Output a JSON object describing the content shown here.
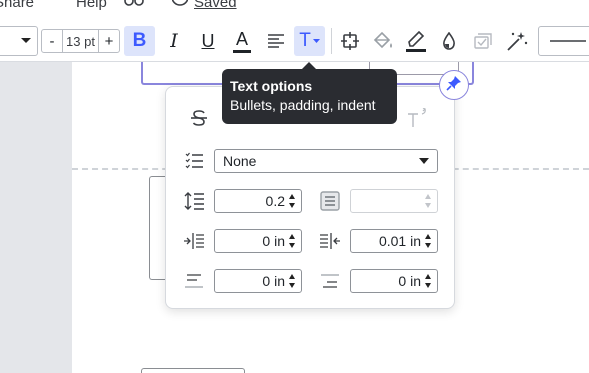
{
  "menubar": {
    "items": [
      {
        "label": "Share"
      },
      {
        "label": "Help"
      }
    ],
    "saved_label": "Saved"
  },
  "toolbar": {
    "font_size_value": "13 pt",
    "decrease_label": "-",
    "increase_label": "+",
    "bold_label": "B",
    "italic_label": "I",
    "underline_label": "U",
    "font_color_label": "A",
    "text_options_label": "T"
  },
  "tooltip": {
    "title": "Text options",
    "subtitle": "Bullets, padding, indent"
  },
  "text_options": {
    "bullet_style": "None",
    "line_spacing": "0.2",
    "paragraph_spacing": "",
    "left_indent": "0 in",
    "right_indent": "0.01 in",
    "space_before": "0 in",
    "space_after": "0 in"
  },
  "colors": {
    "accent": "#3d5afe",
    "active_bg": "#dde4fb",
    "selection_border": "#8a86dd",
    "tooltip_bg": "#2a2c31"
  }
}
